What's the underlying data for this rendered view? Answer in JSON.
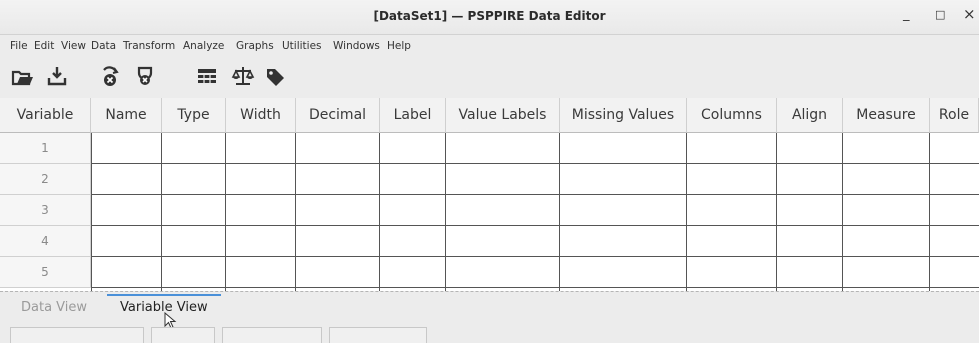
{
  "window": {
    "title": "[DataSet1] — PSPPIRE Data Editor",
    "minimize": "_",
    "maximize": "□",
    "close": "×"
  },
  "menu": [
    "File",
    "Edit",
    "View",
    "Data",
    "Transform",
    "Analyze",
    "Graphs",
    "Utilities",
    "Windows",
    "Help"
  ],
  "toolbar": [
    "open-file-icon",
    "save-icon",
    "goto-case-icon",
    "goto-variable-icon",
    "split-file-icon",
    "weight-cases-icon",
    "value-labels-icon"
  ],
  "grid": {
    "headers": [
      "Variable",
      "Name",
      "Type",
      "Width",
      "Decimal",
      "Label",
      "Value Labels",
      "Missing Values",
      "Columns",
      "Align",
      "Measure",
      "Role"
    ],
    "rows": [
      "1",
      "2",
      "3",
      "4",
      "5"
    ]
  },
  "tabs": {
    "data_view": "Data View",
    "variable_view": "Variable View",
    "active": "variable_view"
  },
  "colors": {
    "tab_indicator": "#4a90d9",
    "grid_lines": "#555555",
    "header_bg": "#f2f2f2"
  }
}
